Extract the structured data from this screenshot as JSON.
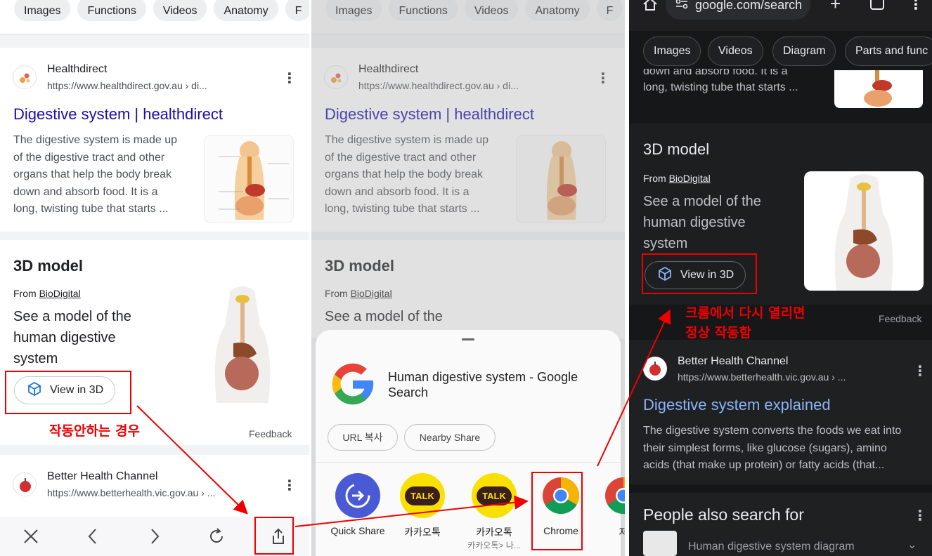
{
  "panel1": {
    "chips": [
      "Images",
      "Functions",
      "Videos",
      "Anatomy",
      "F"
    ],
    "result1": {
      "source": "Healthdirect",
      "url": "https://www.healthdirect.gov.au › di...",
      "title": "Digestive system | healthdirect",
      "snippet": [
        "The digestive system is made up",
        "of the digestive tract and other",
        "organs that help the body break",
        "down and absorb food. It is a",
        "long, twisting tube that starts ..."
      ]
    },
    "model": {
      "heading": "3D model",
      "from_prefix": "From ",
      "from_link": "BioDigital",
      "see": [
        "See a model of the",
        "human digestive",
        "system"
      ],
      "button": "View in 3D",
      "feedback": "Feedback"
    },
    "result2": {
      "source": "Better Health Channel",
      "url": "https://www.betterhealth.vic.gov.au › ..."
    },
    "annotation": "작동안하는 경우"
  },
  "panel2": {
    "chips": [
      "Images",
      "Functions",
      "Videos",
      "Anatomy",
      "F"
    ],
    "result1": {
      "source": "Healthdirect",
      "url": "https://www.healthdirect.gov.au › di...",
      "title": "Digestive system | healthdirect",
      "snippet": [
        "The digestive system is made up",
        "of the digestive tract and other",
        "organs that help the body break",
        "down and absorb food. It is a",
        "long, twisting tube that starts ..."
      ]
    },
    "model": {
      "heading": "3D model",
      "from_prefix": "From ",
      "from_link": "BioDigital",
      "see": "See a model of the"
    },
    "share": {
      "title": [
        "Human digestive system - Google",
        "Search"
      ],
      "copy_url": "URL 복사",
      "nearby": "Nearby Share",
      "apps": [
        {
          "label": "Quick Share",
          "sub": ""
        },
        {
          "label": "카카오톡",
          "sub": ""
        },
        {
          "label": "카카오톡",
          "sub": "카카오톡> 나..."
        },
        {
          "label": "Chrome",
          "sub": ""
        },
        {
          "label": "저",
          "sub": ""
        }
      ]
    }
  },
  "panel3": {
    "url": "google.com/search",
    "chips": [
      "Images",
      "Videos",
      "Diagram",
      "Parts and func"
    ],
    "snippet_tail": [
      "down and absorb food. It is a",
      "long, twisting tube that starts ..."
    ],
    "model": {
      "heading": "3D model",
      "from_prefix": "From ",
      "from_link": "BioDigital",
      "see": [
        "See a model of the",
        "human digestive",
        "system"
      ],
      "button": "View in 3D",
      "feedback": "Feedback"
    },
    "annotation": [
      "크롬에서 다시 열리면",
      "정상 작동함"
    ],
    "result2": {
      "source": "Better Health Channel",
      "url": "https://www.betterhealth.vic.gov.au › ...",
      "title": "Digestive system explained",
      "snippet": [
        "The digestive system converts the foods we eat into",
        "their simplest forms, like glucose (sugars), amino",
        "acids (that make up protein) or fatty acids (that..."
      ]
    },
    "people": {
      "heading": "People also search for",
      "item": "Human digestive system diagram"
    }
  },
  "colors": {
    "annotation_red": "#ee0000",
    "link_blue": "#1a0dab",
    "dark_link": "#8ab4f8",
    "dark_bg": "#161719"
  }
}
